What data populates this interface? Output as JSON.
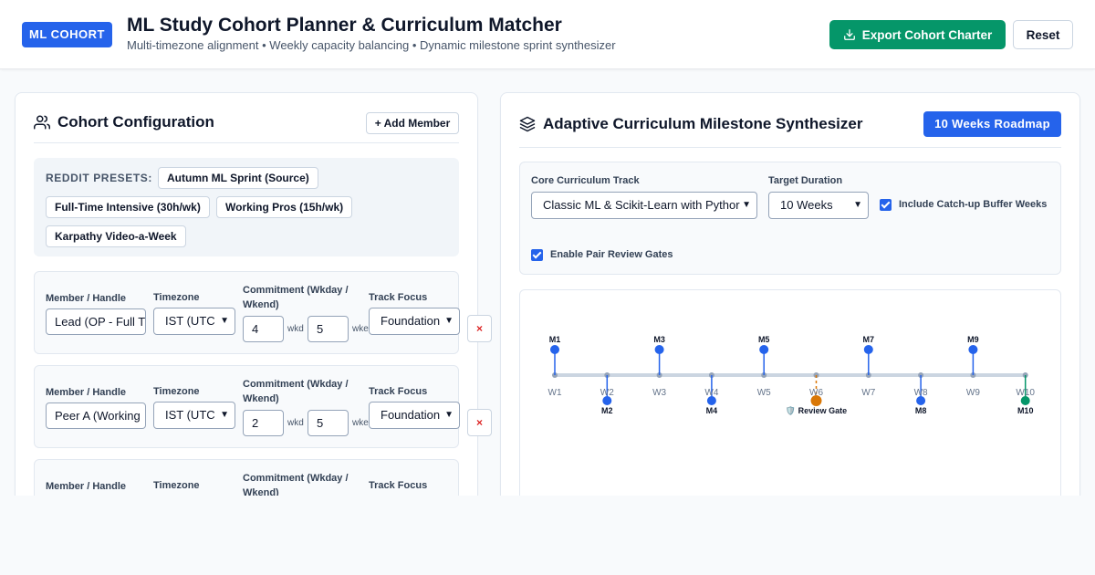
{
  "header": {
    "logo": "ML COHORT",
    "title": "ML Study Cohort Planner & Curriculum Matcher",
    "subtitle": "Multi-timezone alignment • Weekly capacity balancing • Dynamic milestone sprint synthesizer",
    "export_label": "Export Cohort Charter",
    "reset_label": "Reset"
  },
  "cohort": {
    "title": "Cohort Configuration",
    "add_member_label": "+ Add Member",
    "presets_label": "REDDIT PRESETS:",
    "presets": [
      "Autumn ML Sprint (Source)",
      "Full-Time Intensive (30h/wk)",
      "Working Pros (15h/wk)",
      "Karpathy Video-a-Week"
    ],
    "field_labels": {
      "member": "Member / Handle",
      "timezone": "Timezone",
      "commitment": "Commitment (Wkday / Wkend)",
      "track": "Track Focus"
    },
    "units": {
      "weekday": "wkd",
      "weekend": "wke"
    },
    "delete_label": "×",
    "members": [
      {
        "handle": "Lead (OP - Full T",
        "timezone": "IST (UTC",
        "weekday": "4",
        "weekend": "5",
        "track": "Foundation"
      },
      {
        "handle": "Peer A (Working",
        "timezone": "IST (UTC",
        "weekday": "2",
        "weekend": "5",
        "track": "Foundation"
      },
      {
        "handle": "",
        "timezone": "",
        "weekday": "",
        "weekend": "",
        "track": ""
      }
    ]
  },
  "curriculum": {
    "title": "Adaptive Curriculum Milestone Synthesizer",
    "badge": "10 Weeks Roadmap",
    "track_label": "Core Curriculum Track",
    "track_value": "Classic ML & Scikit-Learn with Pythor",
    "duration_label": "Target Duration",
    "duration_value": "10 Weeks",
    "buffer_label": "Include Catch-up Buffer Weeks",
    "pair_review_label": "Enable Pair Review Gates",
    "timeline": {
      "weeks": [
        "W1",
        "W2",
        "W3",
        "W4",
        "W5",
        "W6",
        "W7",
        "W8",
        "W9",
        "W10"
      ],
      "milestones": [
        {
          "label": "M1",
          "week": 1,
          "side": "top",
          "color": "#2563eb"
        },
        {
          "label": "M2",
          "week": 2,
          "side": "bottom",
          "color": "#2563eb"
        },
        {
          "label": "M3",
          "week": 3,
          "side": "top",
          "color": "#2563eb"
        },
        {
          "label": "M4",
          "week": 4,
          "side": "bottom",
          "color": "#2563eb"
        },
        {
          "label": "M5",
          "week": 5,
          "side": "top",
          "color": "#2563eb"
        },
        {
          "label": "🛡️ Review Gate",
          "week": 6,
          "side": "bottom",
          "color": "#d97706",
          "gate": true
        },
        {
          "label": "M7",
          "week": 7,
          "side": "top",
          "color": "#2563eb"
        },
        {
          "label": "M8",
          "week": 8,
          "side": "bottom",
          "color": "#2563eb"
        },
        {
          "label": "M9",
          "week": 9,
          "side": "top",
          "color": "#2563eb"
        },
        {
          "label": "M10",
          "week": 10,
          "side": "bottom",
          "color": "#059669"
        }
      ]
    }
  },
  "colors": {
    "primary": "#2563eb",
    "success": "#059669",
    "gate": "#d97706",
    "danger": "#dc2626"
  }
}
